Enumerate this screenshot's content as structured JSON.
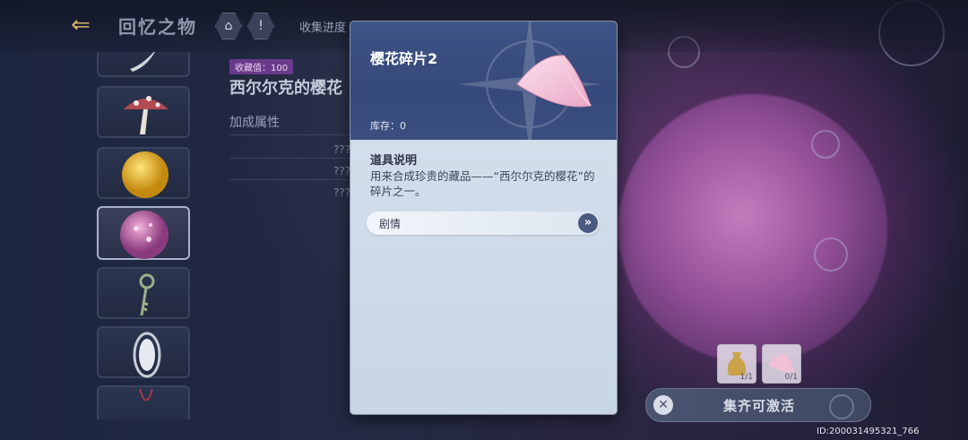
{
  "header": {
    "title": "回忆之物",
    "home_icon": "home-icon",
    "hint_icon": "!",
    "progress_label": "收集进度"
  },
  "item_list": [
    {
      "name": "item-feather"
    },
    {
      "name": "item-mushroom"
    },
    {
      "name": "item-yellow-orb"
    },
    {
      "name": "item-pink-orb",
      "selected": true
    },
    {
      "name": "item-key"
    },
    {
      "name": "item-mirror"
    },
    {
      "name": "item-necklace"
    }
  ],
  "detail": {
    "collect_value": "收藏值：100",
    "name": "西尔尔克的樱花",
    "attr_title": "加成属性",
    "attr_values": [
      "???",
      "???",
      "???"
    ]
  },
  "modal": {
    "title": "樱花碎片2",
    "stock": "库存：0",
    "desc_title": "道具说明",
    "desc_text": "用来合成珍贵的藏品——“西尔尔克的樱花”的碎片之一。",
    "story_label": "剧情",
    "story_arrow": "»"
  },
  "requirements": [
    {
      "name": "req-bag",
      "count": "1/1"
    },
    {
      "name": "req-sakura-fragment",
      "count": "0/1"
    }
  ],
  "activate": {
    "close": "✕",
    "label": "集齐可激活"
  },
  "uid": "ID:2000314953​21_766"
}
